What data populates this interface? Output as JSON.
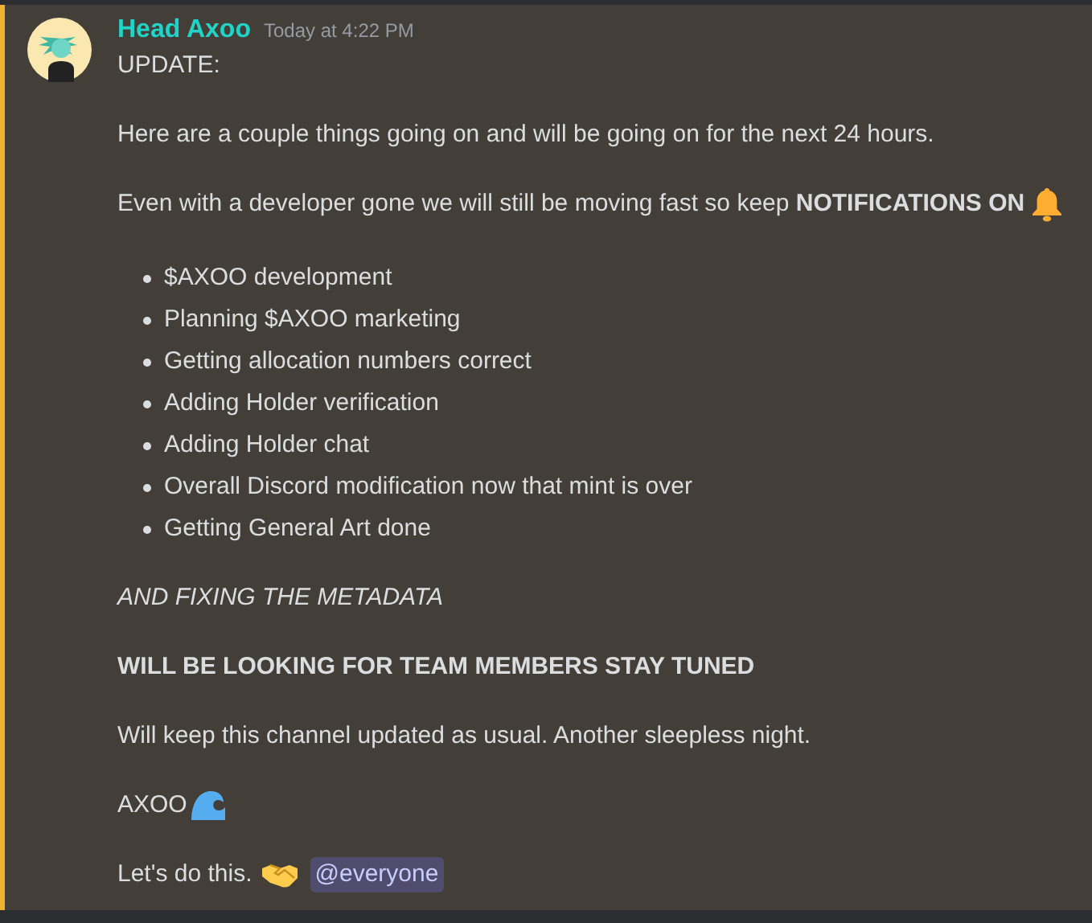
{
  "message": {
    "author": "Head Axoo",
    "timestamp": "Today at 4:22 PM",
    "mentioned": true,
    "blocks": [
      {
        "kind": "text",
        "text": "UPDATE:"
      },
      {
        "kind": "text",
        "text": "Here are a couple things going on and will be going on for the next 24 hours."
      },
      {
        "kind": "text",
        "text": "Even with a developer gone we will still be moving fast so keep **NOTIFICATIONS ON**"
      },
      {
        "kind": "list",
        "items": [
          "$AXOO development",
          "Planning $AXOO marketing",
          "Getting allocation numbers correct",
          "Adding Holder verification",
          "Adding Holder chat",
          "Overall Discord modification now that mint is over",
          "Getting General Art done"
        ]
      },
      {
        "kind": "italic",
        "text": "AND FIXING THE METADATA"
      },
      {
        "kind": "bold",
        "text": "WILL BE LOOKING FOR TEAM MEMBERS STAY TUNED"
      },
      {
        "kind": "text",
        "text": "Will keep this channel updated as usual. Another sleepless night."
      },
      {
        "kind": "text",
        "text": "AXOO"
      },
      {
        "kind": "text",
        "text": "Let's do this.",
        "mention": "@everyone"
      }
    ]
  }
}
